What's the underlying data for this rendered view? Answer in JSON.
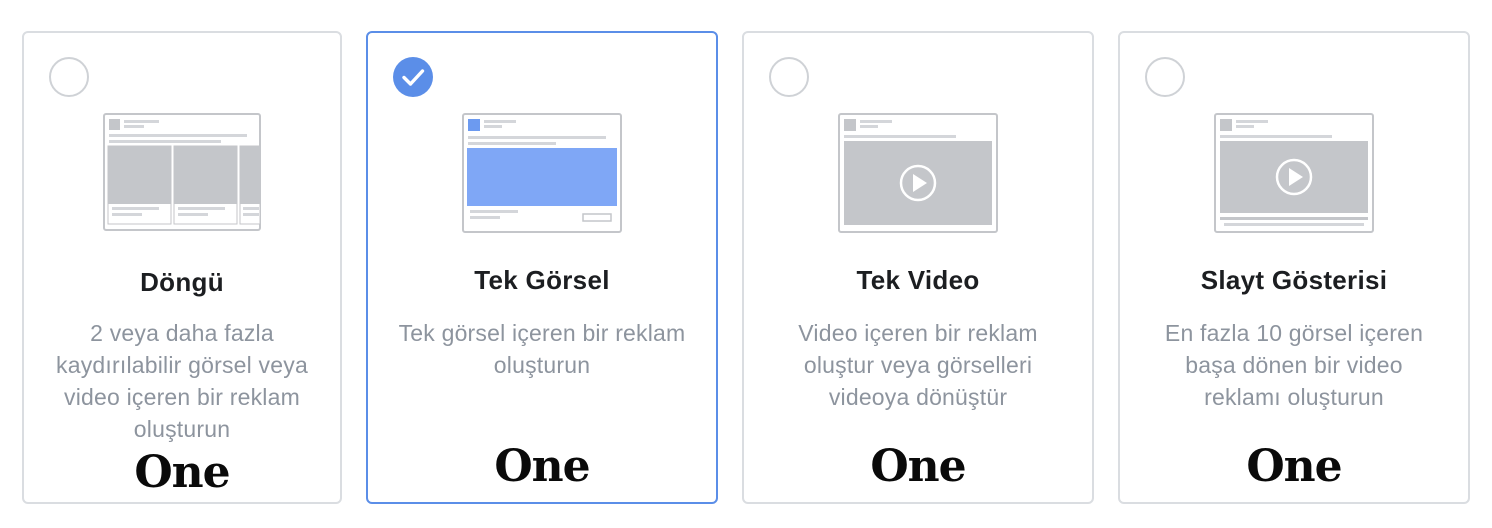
{
  "selected_index": 1,
  "colors": {
    "accent": "#5b8ee8",
    "border": "#dadde1",
    "title": "#1c1e21",
    "description": "#8d949e",
    "placeholder_gray": "#c4c6ca"
  },
  "cards": [
    {
      "title": "Döngü",
      "description": "2 veya daha fazla kaydırılabilir görsel veya video içeren bir reklam oluşturun",
      "logo": "One",
      "illustration": "carousel"
    },
    {
      "title": "Tek Görsel",
      "description": "Tek görsel içeren bir reklam oluşturun",
      "logo": "One",
      "illustration": "single-image"
    },
    {
      "title": "Tek Video",
      "description": "Video içeren bir reklam oluştur veya görselleri videoya dönüştür",
      "logo": "One",
      "illustration": "single-video"
    },
    {
      "title": "Slayt Gösterisi",
      "description": "En fazla 10 görsel içeren başa dönen bir video reklamı oluşturun",
      "logo": "One",
      "illustration": "slideshow"
    }
  ]
}
